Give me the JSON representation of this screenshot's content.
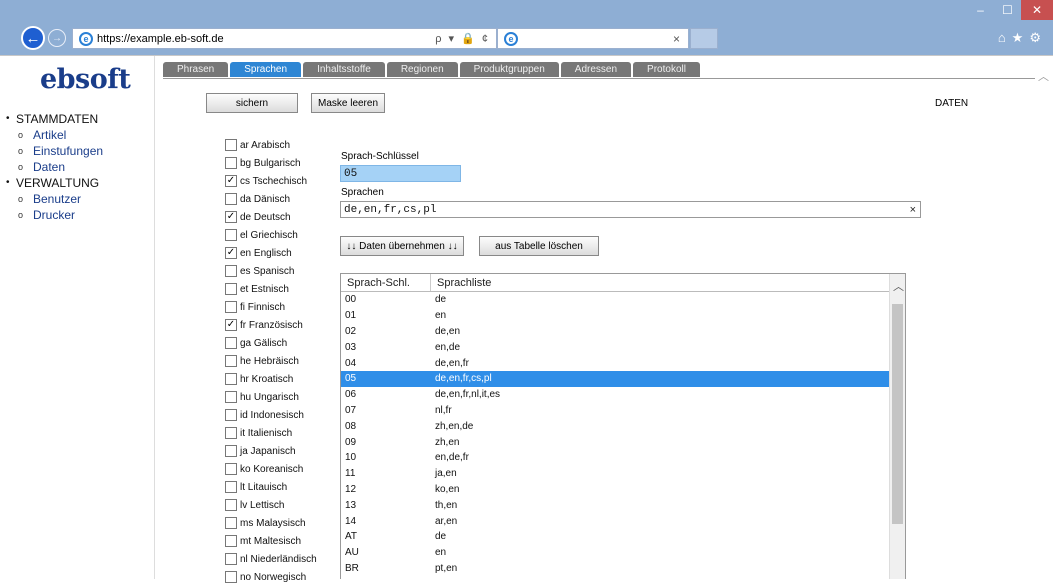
{
  "browser": {
    "url": "https://example.eb-soft.de",
    "tab_title": "",
    "addr_controls": "ρ ▾ 🔒 ¢",
    "tab_close": "×"
  },
  "sidebar": {
    "logo": "ebsoft",
    "sections": [
      {
        "label": "STAMMDATEN",
        "items": [
          "Artikel",
          "Einstufungen",
          "Daten"
        ]
      },
      {
        "label": "VERWALTUNG",
        "items": [
          "Benutzer",
          "Drucker"
        ]
      }
    ]
  },
  "tabs": [
    "Phrasen",
    "Sprachen",
    "Inhaltsstoffe",
    "Regionen",
    "Produktgruppen",
    "Adressen",
    "Protokoll"
  ],
  "active_tab": "Sprachen",
  "toolbar": {
    "save_label": "sichern",
    "clear_label": "Maske leeren"
  },
  "section_title": "DATEN",
  "languages": [
    {
      "label": "ar Arabisch",
      "checked": false
    },
    {
      "label": "bg Bulgarisch",
      "checked": false
    },
    {
      "label": "cs Tschechisch",
      "checked": true
    },
    {
      "label": "da Dänisch",
      "checked": false
    },
    {
      "label": "de Deutsch",
      "checked": true
    },
    {
      "label": "el Griechisch",
      "checked": false
    },
    {
      "label": "en Englisch",
      "checked": true
    },
    {
      "label": "es Spanisch",
      "checked": false
    },
    {
      "label": "et Estnisch",
      "checked": false
    },
    {
      "label": "fi Finnisch",
      "checked": false
    },
    {
      "label": "fr Französisch",
      "checked": true
    },
    {
      "label": "ga Gälisch",
      "checked": false
    },
    {
      "label": "he Hebräisch",
      "checked": false
    },
    {
      "label": "hr Kroatisch",
      "checked": false
    },
    {
      "label": "hu Ungarisch",
      "checked": false
    },
    {
      "label": "id Indonesisch",
      "checked": false
    },
    {
      "label": "it Italienisch",
      "checked": false
    },
    {
      "label": "ja Japanisch",
      "checked": false
    },
    {
      "label": "ko Koreanisch",
      "checked": false
    },
    {
      "label": "lt Litauisch",
      "checked": false
    },
    {
      "label": "lv Lettisch",
      "checked": false
    },
    {
      "label": "ms Malaysisch",
      "checked": false
    },
    {
      "label": "mt Maltesisch",
      "checked": false
    },
    {
      "label": "nl Niederländisch",
      "checked": false
    },
    {
      "label": "no Norwegisch",
      "checked": false
    }
  ],
  "form": {
    "key_label": "Sprach-Schlüssel",
    "key_value": "05",
    "langs_label": "Sprachen",
    "langs_value": "de,en,fr,cs,pl",
    "clear_icon": "×",
    "apply_label": "↓↓ Daten übernehmen ↓↓",
    "delete_label": "aus Tabelle löschen"
  },
  "table": {
    "headers": [
      "Sprach-Schl.",
      "Sprachliste"
    ],
    "selected_index": 5,
    "rows": [
      [
        "00",
        "de"
      ],
      [
        "01",
        "en"
      ],
      [
        "02",
        "de,en"
      ],
      [
        "03",
        "en,de"
      ],
      [
        "04",
        "de,en,fr"
      ],
      [
        "05",
        "de,en,fr,cs,pl"
      ],
      [
        "06",
        "de,en,fr,nl,it,es"
      ],
      [
        "07",
        "nl,fr"
      ],
      [
        "08",
        "zh,en,de"
      ],
      [
        "09",
        "zh,en"
      ],
      [
        "10",
        "en,de,fr"
      ],
      [
        "11",
        "ja,en"
      ],
      [
        "12",
        "ko,en"
      ],
      [
        "13",
        "th,en"
      ],
      [
        "14",
        "ar,en"
      ],
      [
        "AT",
        "de"
      ],
      [
        "AU",
        "en"
      ],
      [
        "BR",
        "pt,en"
      ]
    ]
  },
  "colors": {
    "accent": "#2e86d4",
    "selected_row": "#2f8ee8",
    "key_field": "#a5d2f6",
    "logo": "#1a3d8a"
  }
}
